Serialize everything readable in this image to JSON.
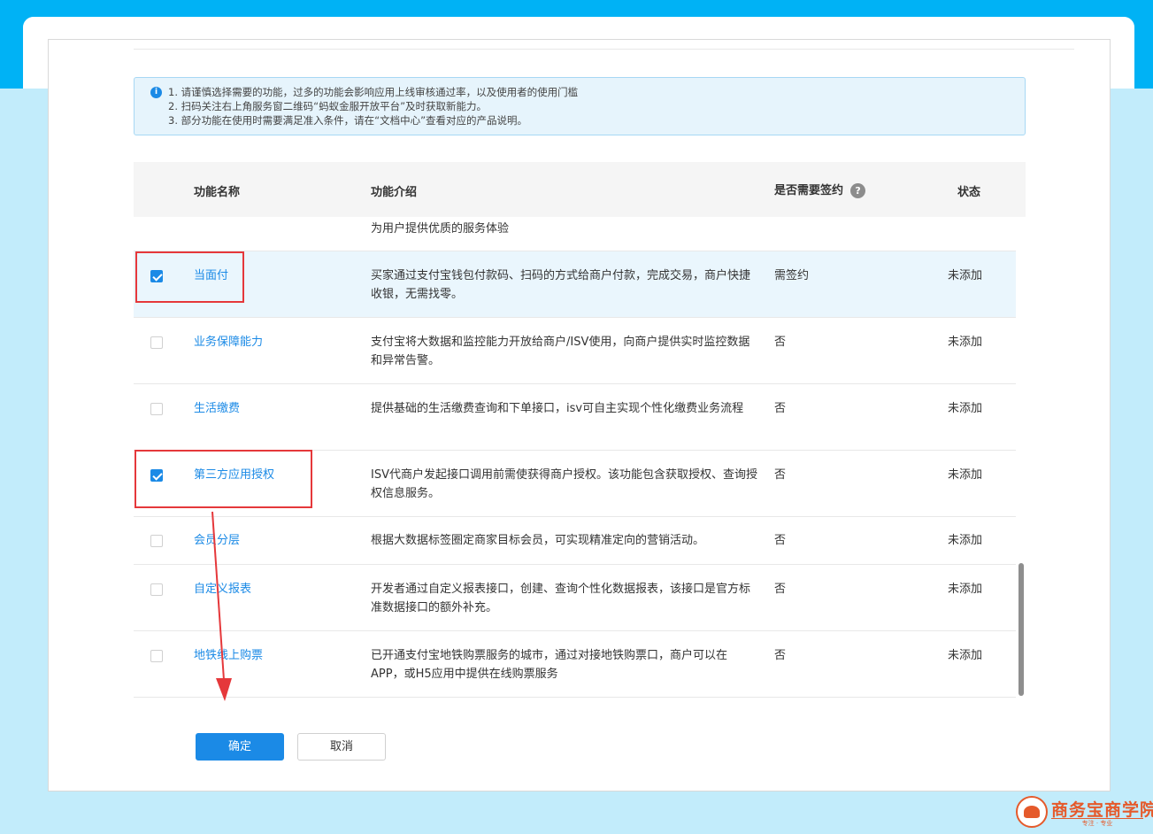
{
  "notice": {
    "icon": "info-icon",
    "badge": "i",
    "lines": [
      "1. 请谨慎选择需要的功能，过多的功能会影响应用上线审核通过率，以及使用者的使用门槛",
      "2. 扫码关注右上角服务窗二维码“蚂蚁金服开放平台”及时获取新能力。",
      "3. 部分功能在使用时需要满足准入条件，请在“文档中心”查看对应的产品说明。"
    ]
  },
  "table": {
    "headers": {
      "name": "功能名称",
      "desc": "功能介绍",
      "sign": "是否需要签约",
      "sign_help": "?",
      "status": "状态"
    },
    "partial_desc": "为用户提供优质的服务体验",
    "rows": [
      {
        "checked": true,
        "name": "当面付",
        "desc": "买家通过支付宝钱包付款码、扫码的方式给商户付款，完成交易，商户快捷收银，无需找零。",
        "sign": "需签约",
        "status": "未添加"
      },
      {
        "checked": false,
        "name": "业务保障能力",
        "desc": "支付宝将大数据和监控能力开放给商户/ISV使用，向商户提供实时监控数据和异常告警。",
        "sign": "否",
        "status": "未添加"
      },
      {
        "checked": false,
        "name": "生活缴费",
        "desc": "提供基础的生活缴费查询和下单接口，isv可自主实现个性化缴费业务流程",
        "sign": "否",
        "status": "未添加"
      },
      {
        "checked": true,
        "name": "第三方应用授权",
        "desc": "ISV代商户发起接口调用前需使获得商户授权。该功能包含获取授权、查询授权信息服务。",
        "sign": "否",
        "status": "未添加"
      },
      {
        "checked": false,
        "name": "会员分层",
        "desc": "根据大数据标签圈定商家目标会员，可实现精准定向的营销活动。",
        "sign": "否",
        "status": "未添加"
      },
      {
        "checked": false,
        "name": "自定义报表",
        "desc": "开发者通过自定义报表接口，创建、查询个性化数据报表，该接口是官方标准数据接口的额外补充。",
        "sign": "否",
        "status": "未添加"
      },
      {
        "checked": false,
        "name": "地铁线上购票",
        "desc": "已开通支付宝地铁购票服务的城市，通过对接地铁购票口，商户可以在APP，或H5应用中提供在线购票服务",
        "sign": "否",
        "status": "未添加"
      }
    ]
  },
  "buttons": {
    "ok": "确定",
    "cancel": "取消"
  },
  "watermark": {
    "text": "商务宝商学院",
    "sub": "专注 · 专业"
  },
  "colors": {
    "background": "#00b2f5",
    "accent": "#1b8ae6",
    "annotation": "#e5383b"
  }
}
